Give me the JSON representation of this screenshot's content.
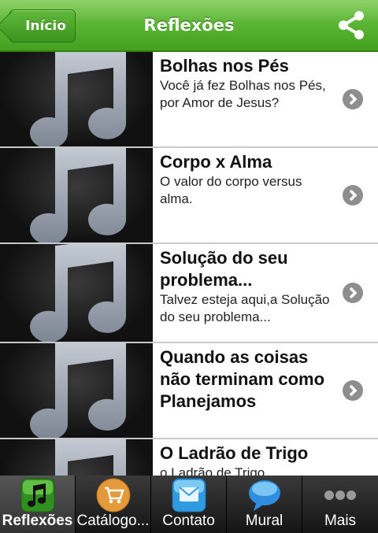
{
  "header": {
    "back_label": "Início",
    "title": "Reflexões",
    "share_icon": "share-icon"
  },
  "items": [
    {
      "title": "Bolhas nos Pés",
      "subtitle": "Você já fez Bolhas nos Pés, por Amor de Jesus?"
    },
    {
      "title": "Corpo x Alma",
      "subtitle": "O valor do corpo versus alma."
    },
    {
      "title": "Solução do seu problema...",
      "subtitle": "Talvez esteja aqui,a Solução do seu problema..."
    },
    {
      "title": "Quando as coisas não terminam como Planejamos",
      "subtitle": ""
    },
    {
      "title": "O Ladrão de Trigo",
      "subtitle": "o Ladrão de Trigo"
    }
  ],
  "tabs": [
    {
      "label": "Reflexões",
      "icon": "music-note-icon"
    },
    {
      "label": "Catálogo...",
      "icon": "shopping-cart-icon"
    },
    {
      "label": "Contato",
      "icon": "contact-icon"
    },
    {
      "label": "Mural",
      "icon": "speech-bubble-icon"
    },
    {
      "label": "Mais",
      "icon": "more-dots-icon"
    }
  ],
  "colors": {
    "header_green": "#5cb536",
    "tabbar_dark": "#222222"
  }
}
